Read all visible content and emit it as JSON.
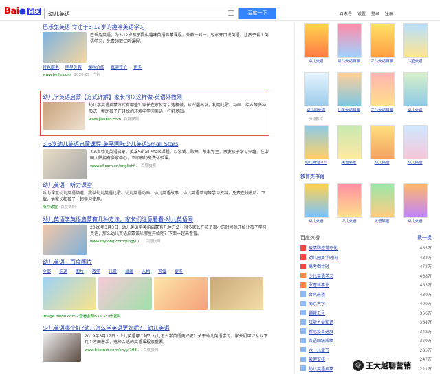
{
  "header": {
    "logo": "Bai",
    "logo_paw": "●",
    "logo_cn": "百度",
    "query": "幼儿英语",
    "search_button": "百度一下",
    "top_links": [
      "百家号",
      "设置",
      "登录",
      "注册"
    ]
  },
  "results": [
    {
      "title": "巴乐兔英语·专注于3-12岁的趣味英语学习",
      "text": "巴乐兔英语，为3-12岁孩子提供趣味英语启蒙课程，外教一对一，轻松开口说英语，让孩子爱上英语学习，免费领取试听课程。",
      "links": [
        "特色服务",
        "明星外教",
        "课程介绍",
        "真实评价",
        "更多"
      ],
      "url": "www.beile.com",
      "date": "2020-05",
      "ad": "广告"
    },
    {
      "title": "幼儿学英语启蒙【方式详解】家长可以这样做-英语外教网",
      "text": "幼儿学英语启蒙方式有哪些？家长在家就可以这样做，从兴趣出发，利用儿歌、动画、绘本等多种形式，帮助孩子在轻松的环境中学习英语，打好基础。",
      "url": "www.jianrao.com",
      "action": "百度快照"
    },
    {
      "title": "3-6岁幼儿英语启蒙课程-英孚国际少儿英语Small Stars",
      "text": "3-6岁幼儿英语启蒙，英孚Small Stars课程，以游戏、歌曲、故事为主，激发孩子学习兴趣，在中国大陆拥有多家中心，立即预约免费体验课。",
      "url": "www.ef.com.cn/englishf...",
      "action": "百度快照"
    },
    {
      "title": "幼儿英语 - 听力课堂",
      "text": "听力课堂幼儿英语频道，提供幼儿英语儿歌、幼儿英语动画、幼儿英语故事、幼儿英语单词等学习资料，免费在线收听、下载，供家长和孩子一起学习使用。",
      "actions": [
        "听力课堂",
        "百度快照"
      ]
    },
    {
      "title": "幼儿英语学英语启蒙有几种方法，家长们注意看看-幼儿英语网",
      "text": "2020年3月3日 · 幼儿英语学英语启蒙有几种方法，很多家长在孩子很小的时候就开始让孩子学习英语，那么幼儿英语启蒙该从哪里开始呢？下面一起来看看。",
      "url": "www.myfong.com/yingyu/...",
      "action": "百度快照"
    },
    {
      "title": "幼儿英语 - 百度图片",
      "tabs": [
        "全部",
        "卡通",
        "图片",
        "教学",
        "儿童",
        "插画",
        "人物",
        "可爱",
        "更多"
      ],
      "source": "image.baidu.com - 查看全部633,339张图片"
    },
    {
      "title": "少儿英语哪个好?幼儿怎么学英语更好呢? - 幼儿英语",
      "text": "2019年3月17日 · 少儿英语哪个好？幼儿怎么学英语更好呢？关于幼儿英语学习，家长们可以从以下几个方面着手，选择合适的英语课程很重要。",
      "url": "www.bestnct.com/cnyy/198...",
      "action": "百度快照"
    }
  ],
  "sidebar": {
    "books": [
      {
        "title": "幼儿英语",
        "sub": ""
      },
      {
        "title": "幼儿英语启蒙",
        "sub": ""
      },
      {
        "title": "少儿英语启蒙",
        "sub": ""
      },
      {
        "title": "儿童英语",
        "sub": ""
      },
      {
        "title": "幼儿园英语",
        "sub": "分级教材"
      },
      {
        "title": "儿童英语启蒙",
        "sub": ""
      },
      {
        "title": "少儿英语启蒙",
        "sub": ""
      },
      {
        "title": "幼儿英语",
        "sub": ""
      },
      {
        "title": "幼儿英语100",
        "sub": ""
      },
      {
        "title": "英语启蒙",
        "sub": ""
      },
      {
        "title": "幼儿英语",
        "sub": ""
      },
      {
        "title": "幼儿英语",
        "sub": ""
      }
    ],
    "textbook_heading": "教育类书籍",
    "textbooks": [
      {
        "title": "幼儿英语",
        "sub": ""
      },
      {
        "title": "少儿英语",
        "sub": ""
      },
      {
        "title": "英语启蒙",
        "sub": ""
      },
      {
        "title": "幼儿英语",
        "sub": ""
      }
    ],
    "hot_title": "百度热榜",
    "hot_refresh": "换一换",
    "hot_items": [
      {
        "title": "疫情防控常态化",
        "num": "485万"
      },
      {
        "title": "幼儿园复学时间",
        "num": "483万"
      },
      {
        "title": "高考倒计时",
        "num": "472万"
      },
      {
        "title": "少儿英语学习",
        "num": "468万"
      },
      {
        "title": "罗志祥事件",
        "num": "463万"
      },
      {
        "title": "台风来袭",
        "num": "430万"
      },
      {
        "title": "南京大学",
        "num": "400万"
      },
      {
        "title": "嫦娥五号",
        "num": "366万"
      },
      {
        "title": "垃圾分类知识",
        "num": "364万"
      },
      {
        "title": "新冠疫苗进展",
        "num": "342万"
      },
      {
        "title": "英语四级成绩",
        "num": "320万"
      },
      {
        "title": "六一儿童节",
        "num": "285万"
      },
      {
        "title": "暑假安排",
        "num": "247万"
      },
      {
        "title": "幼儿英语启蒙",
        "num": "221万"
      }
    ]
  },
  "watermark": {
    "icon": "☺",
    "text": "王大越聊营销"
  },
  "colors": {
    "link": "#2440b3",
    "highlight": "#c00",
    "url": "#008000",
    "button": "#3385ff",
    "rank_top": "#f54545",
    "rank_mid": "#ff8547",
    "rank_low": "#8eb9f5"
  }
}
